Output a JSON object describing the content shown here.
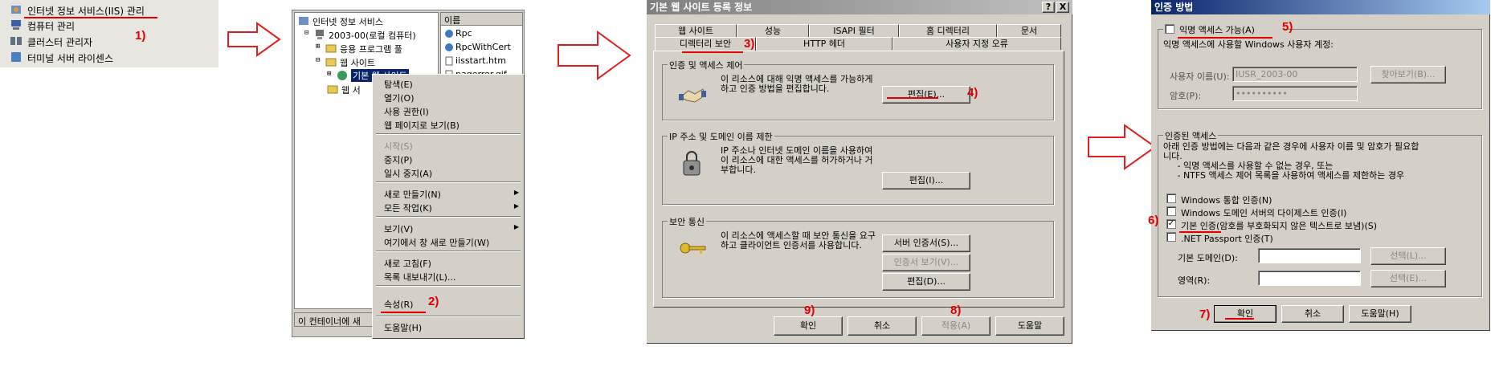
{
  "step1": {
    "items": [
      {
        "label": "인터넷 정보 서비스(IIS) 관리",
        "icon": "iis-icon"
      },
      {
        "label": "컴퓨터 관리",
        "icon": "computer-management-icon"
      },
      {
        "label": "클러스터 관리자",
        "icon": "cluster-icon"
      },
      {
        "label": "터미널 서버 라이센스",
        "icon": "terminal-license-icon"
      }
    ],
    "marker": "1)"
  },
  "step2": {
    "tree": {
      "root": "인터넷 정보 서비스",
      "computer": "2003-00(로컬 컴퓨터)",
      "app_pools": "응용 프로그램 풀",
      "websites": "웹 사이트",
      "default_site": "기본 웹 사이트",
      "web_service": "웹 서"
    },
    "list_header": "이름",
    "list_items": [
      "Rpc",
      "RpcWithCert",
      "iisstart.htm",
      "pagerror.gif"
    ],
    "status_text": "이 컨테이너에 새",
    "context_menu": {
      "items": [
        "탐색(E)",
        "열기(O)",
        "사용 권한(I)",
        "웹 페이지로 보기(B)",
        "시작(S)",
        "중지(P)",
        "일시 중지(A)",
        "새로 만들기(N)",
        "모든 작업(K)",
        "보기(V)",
        "여기에서 창 새로 만들기(W)",
        "새로 고침(F)",
        "목록 내보내기(L)...",
        "속성(R)",
        "도움말(H)"
      ],
      "disabled": [
        "시작(S)"
      ]
    },
    "marker": "2)"
  },
  "step3": {
    "title": "기본 웹 사이트 등록 정보",
    "title_buttons": [
      "?",
      "X"
    ],
    "tabs_row1": [
      "웹 사이트",
      "성능",
      "ISAPI 필터",
      "홈 디렉터리",
      "문서"
    ],
    "tabs_row2": [
      "디렉터리 보안",
      "HTTP 헤더",
      "사용자 지정 오류"
    ],
    "marker_tab": "3)",
    "groups": [
      {
        "label": "인증 및 액세스 제어",
        "text": "이 리소스에 대해 익명 액세스를 가능하게\n하고 인증 방법을 편집합니다.",
        "buttons": [
          "편집(E)..."
        ]
      },
      {
        "label": "IP 주소 및 도메인 이름 제한",
        "text": "IP 주소나 인터넷 도메인 이름을 사용하여\n이 리소스에 대한 액세스를 허가하거나 거\n부합니다.",
        "buttons": [
          "편집(I)..."
        ]
      },
      {
        "label": "보안 통신",
        "text": "이 리소스에 액세스할 때 보안 통신을 요구\n하고 클라이언트 인증서를 사용합니다.",
        "buttons": [
          "서버 인증서(S)...",
          "인증서 보기(V)...",
          "편집(D)..."
        ]
      }
    ],
    "marker_edit": "4)",
    "bottom_buttons": [
      "확인",
      "취소",
      "적용(A)",
      "도움말"
    ],
    "marker_ok": "9)",
    "marker_apply": "8)"
  },
  "step4": {
    "title": "인증 방법",
    "anonymous_label": "익명 액세스 가능(A)",
    "marker_anon": "5)",
    "anonymous_desc": "익명 액세스에 사용할 Windows 사용자 계정:",
    "username_label": "사용자 이름(U):",
    "username_value": "IUSR_2003-00",
    "browse_button": "찾아보기(B)...",
    "password_label": "암호(P):",
    "password_value": "••••••••••",
    "auth_group_label": "인증된 액세스",
    "auth_desc": "아래 인증 방법에는 다음과 같은 경우에 사용자 이름 및 암호가 필요합\n니다.\n     - 익명 액세스를 사용할 수 없는 경우, 또는\n     - NTFS 액세스 제어 목록을 사용하여 액세스를 제한하는 경우",
    "options": [
      {
        "label": "Windows 통합 인증(N)",
        "checked": false
      },
      {
        "label": "Windows 도메인 서버의 다이제스트 인증(I)",
        "checked": false
      },
      {
        "label": "기본 인증(암호를 부호화되지 않은 텍스트로 보냄)(S)",
        "checked": true
      },
      {
        "label": ".NET Passport 인증(T)",
        "checked": false
      }
    ],
    "marker_basic": "6)",
    "default_domain_label": "기본 도메인(D):",
    "realm_label": "영역(R):",
    "select_button": "선택(L)...",
    "select_button2": "선택(E)...",
    "bottom_buttons": [
      "확인",
      "취소",
      "도움말(H)"
    ],
    "marker_ok": "7)"
  },
  "colors": {
    "accent_red": "#e00000",
    "title_gradient_start": "#0a246a",
    "title_gradient_end": "#a6caf0",
    "title_inactive_start": "#808080",
    "title_inactive_end": "#c0c0c0",
    "dialog_bg": "#d4d0c8"
  }
}
